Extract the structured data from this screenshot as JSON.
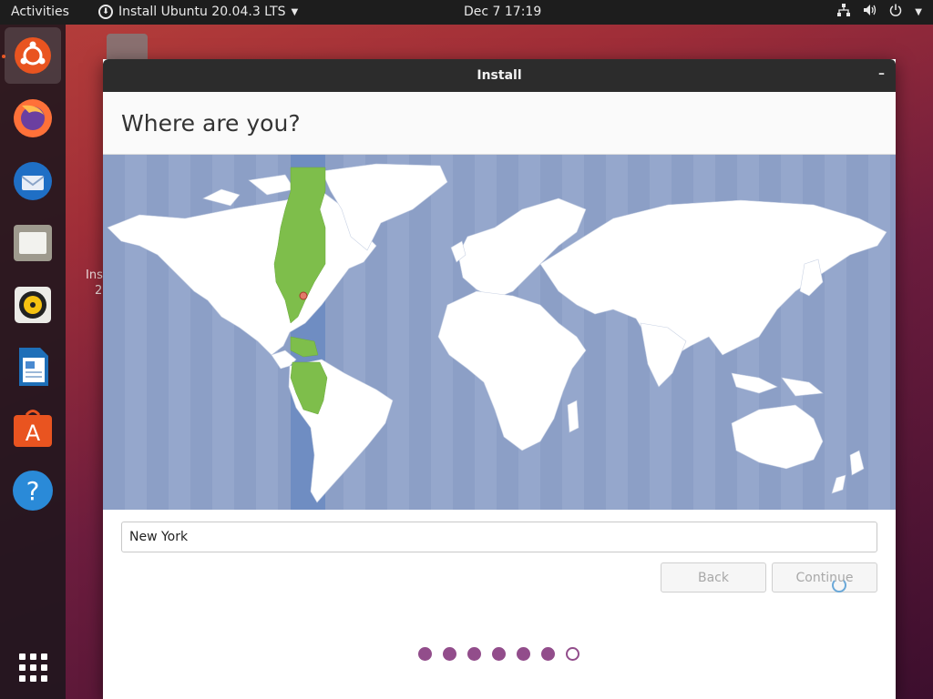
{
  "topbar": {
    "activities": "Activities",
    "app_name": "Install Ubuntu 20.04.3 LTS",
    "app_icon": "installer-icon",
    "clock": "Dec 7  17:19",
    "tray_icons": [
      "network-icon",
      "volume-icon",
      "power-icon"
    ]
  },
  "dock": {
    "items": [
      {
        "name": "ubuntu-installer-icon",
        "active": true
      },
      {
        "name": "firefox-icon"
      },
      {
        "name": "thunderbird-icon"
      },
      {
        "name": "files-icon"
      },
      {
        "name": "rhythmbox-icon"
      },
      {
        "name": "libreoffice-writer-icon"
      },
      {
        "name": "ubuntu-software-icon"
      },
      {
        "name": "help-icon"
      }
    ],
    "apps_grid_icon": "show-applications-icon"
  },
  "desktop": {
    "label_line1": "Ins",
    "label_line2": "2"
  },
  "window": {
    "title": "Install",
    "minimize": "–",
    "heading": "Where are you?",
    "timezone_value": "New York",
    "back_label": "Back",
    "continue_label": "Continue",
    "progress": {
      "total": 7,
      "completed": 6
    },
    "selected_timezone_color": "#7ebe4b",
    "map_ocean_color": "#8c9fc6",
    "accent_color": "#924d8b"
  }
}
